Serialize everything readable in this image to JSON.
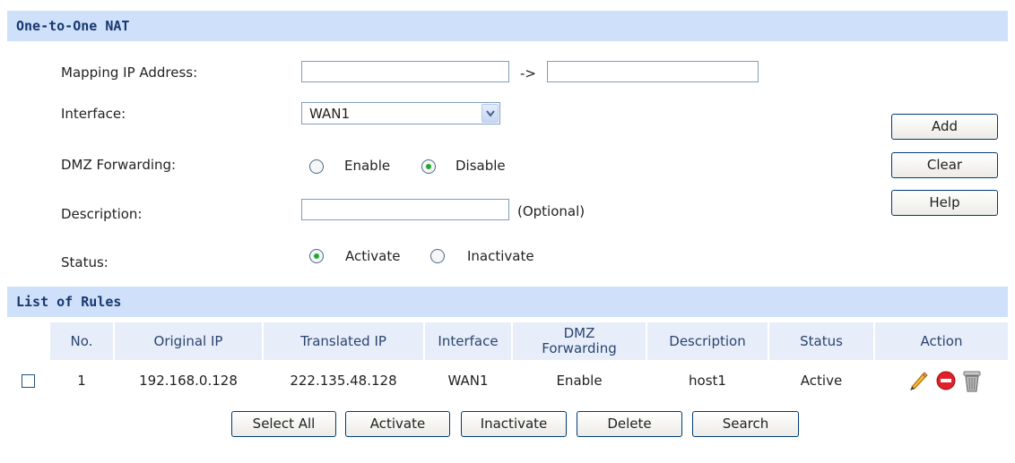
{
  "nat_section": {
    "title": "One-to-One NAT",
    "mapping_label": "Mapping IP Address:",
    "mapping_start_value": "",
    "mapping_arrow": "->",
    "mapping_end_value": "",
    "interface_label": "Interface:",
    "interface_value": "WAN1",
    "dmz_label": "DMZ Forwarding:",
    "dmz_enable_label": "Enable",
    "dmz_disable_label": "Disable",
    "dmz_selected": "Disable",
    "description_label": "Description:",
    "description_value": "",
    "optional_hint": "(Optional)",
    "status_label": "Status:",
    "status_activate_label": "Activate",
    "status_inactivate_label": "Inactivate",
    "status_selected": "Activate",
    "buttons": {
      "add": "Add",
      "clear": "Clear",
      "help": "Help"
    }
  },
  "rules_section": {
    "title": "List of Rules",
    "columns": {
      "no": "No.",
      "original_ip": "Original IP",
      "translated_ip": "Translated IP",
      "interface": "Interface",
      "dmz_line1": "DMZ",
      "dmz_line2": "Forwarding",
      "description": "Description",
      "status": "Status",
      "action": "Action"
    },
    "rows": [
      {
        "no": "1",
        "original_ip": "192.168.0.128",
        "translated_ip": "222.135.48.128",
        "interface": "WAN1",
        "dmz_forwarding": "Enable",
        "description": "host1",
        "status": "Active",
        "actions": [
          "edit-icon",
          "disable-icon",
          "delete-icon"
        ]
      }
    ],
    "buttons": {
      "select_all": "Select All",
      "activate": "Activate",
      "inactivate": "Inactivate",
      "delete": "Delete",
      "search": "Search"
    }
  },
  "colors": {
    "header_bg": "#cfe1fa",
    "header_text": "#17376e",
    "radio_checked": "#22a832"
  }
}
